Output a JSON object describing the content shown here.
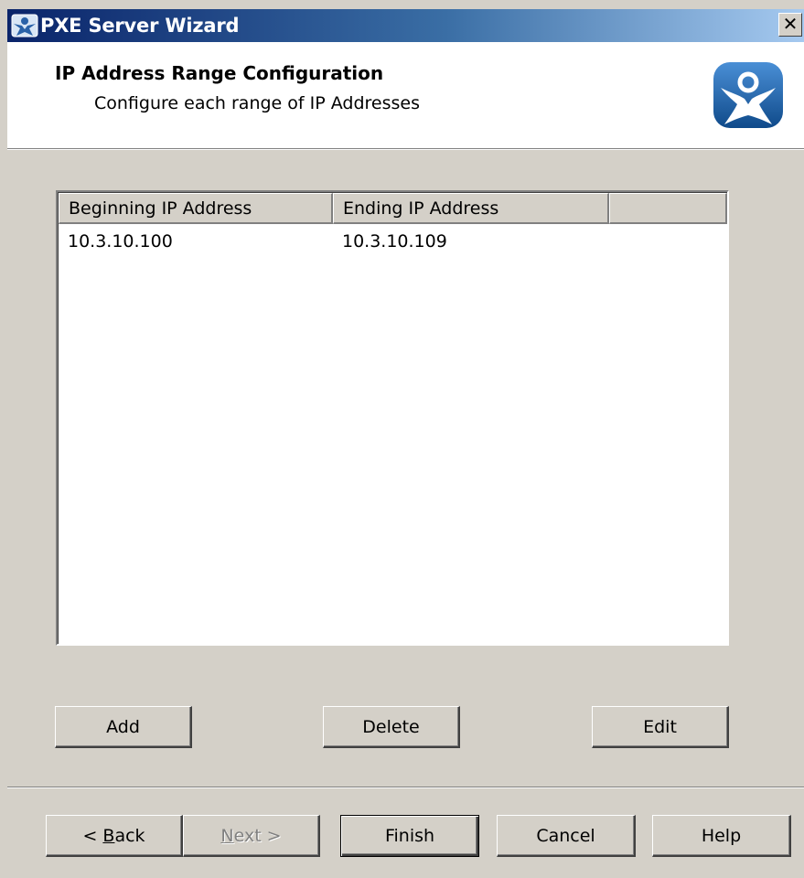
{
  "window": {
    "title": "PXE Server Wizard",
    "close_symbol": "✕"
  },
  "header": {
    "title": "IP Address Range Configuration",
    "subtitle": "Configure each range of IP Addresses",
    "logo_icon": "thinmanager-logo-icon"
  },
  "table": {
    "columns": [
      "Beginning IP Address",
      "Ending IP Address",
      ""
    ],
    "rows": [
      {
        "begin": "10.3.10.100",
        "end": "10.3.10.109"
      }
    ]
  },
  "range_buttons": {
    "add": "Add",
    "delete": "Delete",
    "edit": "Edit"
  },
  "nav_buttons": {
    "back_prefix": "< ",
    "back_mnemonic": "B",
    "back_rest": "ack",
    "next_mnemonic": "N",
    "next_rest": "ext >",
    "finish": "Finish",
    "cancel": "Cancel",
    "help": "Help"
  },
  "colors": {
    "titlebar_start": "#0a246a",
    "titlebar_end": "#a6caf0",
    "dialog_face": "#d4d0c8",
    "logo_blue": "#1f5fa6"
  }
}
